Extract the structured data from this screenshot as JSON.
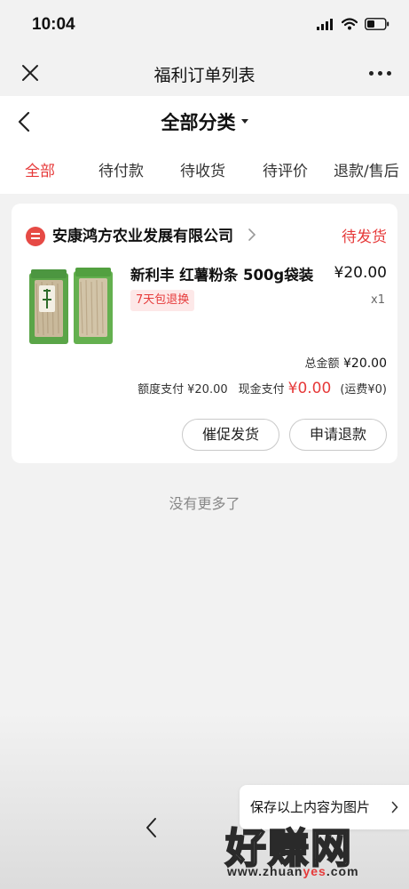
{
  "status_bar": {
    "time": "10:04"
  },
  "title_bar": {
    "title": "福利订单列表"
  },
  "header": {
    "category": "全部分类"
  },
  "tabs": [
    {
      "label": "全部",
      "active": true
    },
    {
      "label": "待付款",
      "active": false
    },
    {
      "label": "待收货",
      "active": false
    },
    {
      "label": "待评价",
      "active": false
    },
    {
      "label": "退款/售后",
      "active": false
    }
  ],
  "order": {
    "shop_name": "安康鸿方农业发展有限公司",
    "status": "待发货",
    "product": {
      "title": "新利丰 红薯粉条 500g袋装",
      "price": "¥20.00",
      "badge": "7天包退换",
      "quantity": "x1"
    },
    "total_label": "总金额",
    "total_value": "¥20.00",
    "quota_label": "额度支付",
    "quota_value": "¥20.00",
    "cash_label": "现金支付",
    "cash_value": "¥0.00",
    "shipping": "(运费¥0)",
    "buttons": {
      "urge": "催促发货",
      "refund": "申请退款"
    }
  },
  "no_more": "没有更多了",
  "save_tip": "保存以上内容为图片",
  "watermark": {
    "main": "好赚网",
    "url_prefix": "www.zhuan",
    "url_highlight": "yes",
    "url_suffix": ".com"
  },
  "colors": {
    "accent": "#e63a3a",
    "background": "#f2f2f2",
    "card": "#ffffff"
  }
}
